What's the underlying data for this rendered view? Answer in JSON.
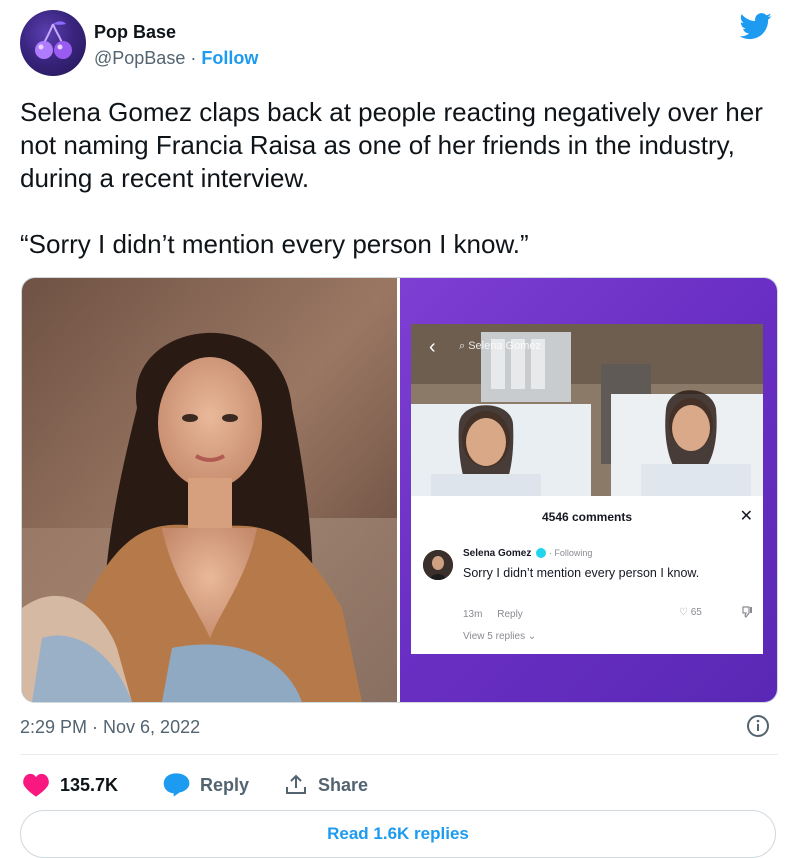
{
  "author": {
    "name": "Pop Base",
    "handle": "@PopBase",
    "separator": "·",
    "follow_label": "Follow"
  },
  "tweet": {
    "text": "Selena Gomez claps back at people reacting negatively over her not naming Francia Raisa as one of her friends in the industry, during a recent interview.",
    "quote": "“Sorry I didn’t mention every person I know.”"
  },
  "media": {
    "tiktok": {
      "search_text": "Selena Gomez",
      "comments_count": "4546 comments",
      "close_glyph": "✕",
      "comment": {
        "author": "Selena Gomez",
        "following": "· Following",
        "text": "Sorry I didn’t mention every person I know.",
        "time": "13m",
        "reply_label": "Reply",
        "likes": "65",
        "view_replies": "View 5 replies"
      }
    }
  },
  "meta": {
    "timestamp": "2:29 PM · Nov 6, 2022"
  },
  "actions": {
    "likes": "135.7K",
    "reply_label": "Reply",
    "share_label": "Share"
  },
  "read_replies_label": "Read 1.6K replies",
  "colors": {
    "accent": "#1d9bf0",
    "like": "#f91880",
    "tiktok_bg": "#6a2fc4"
  }
}
